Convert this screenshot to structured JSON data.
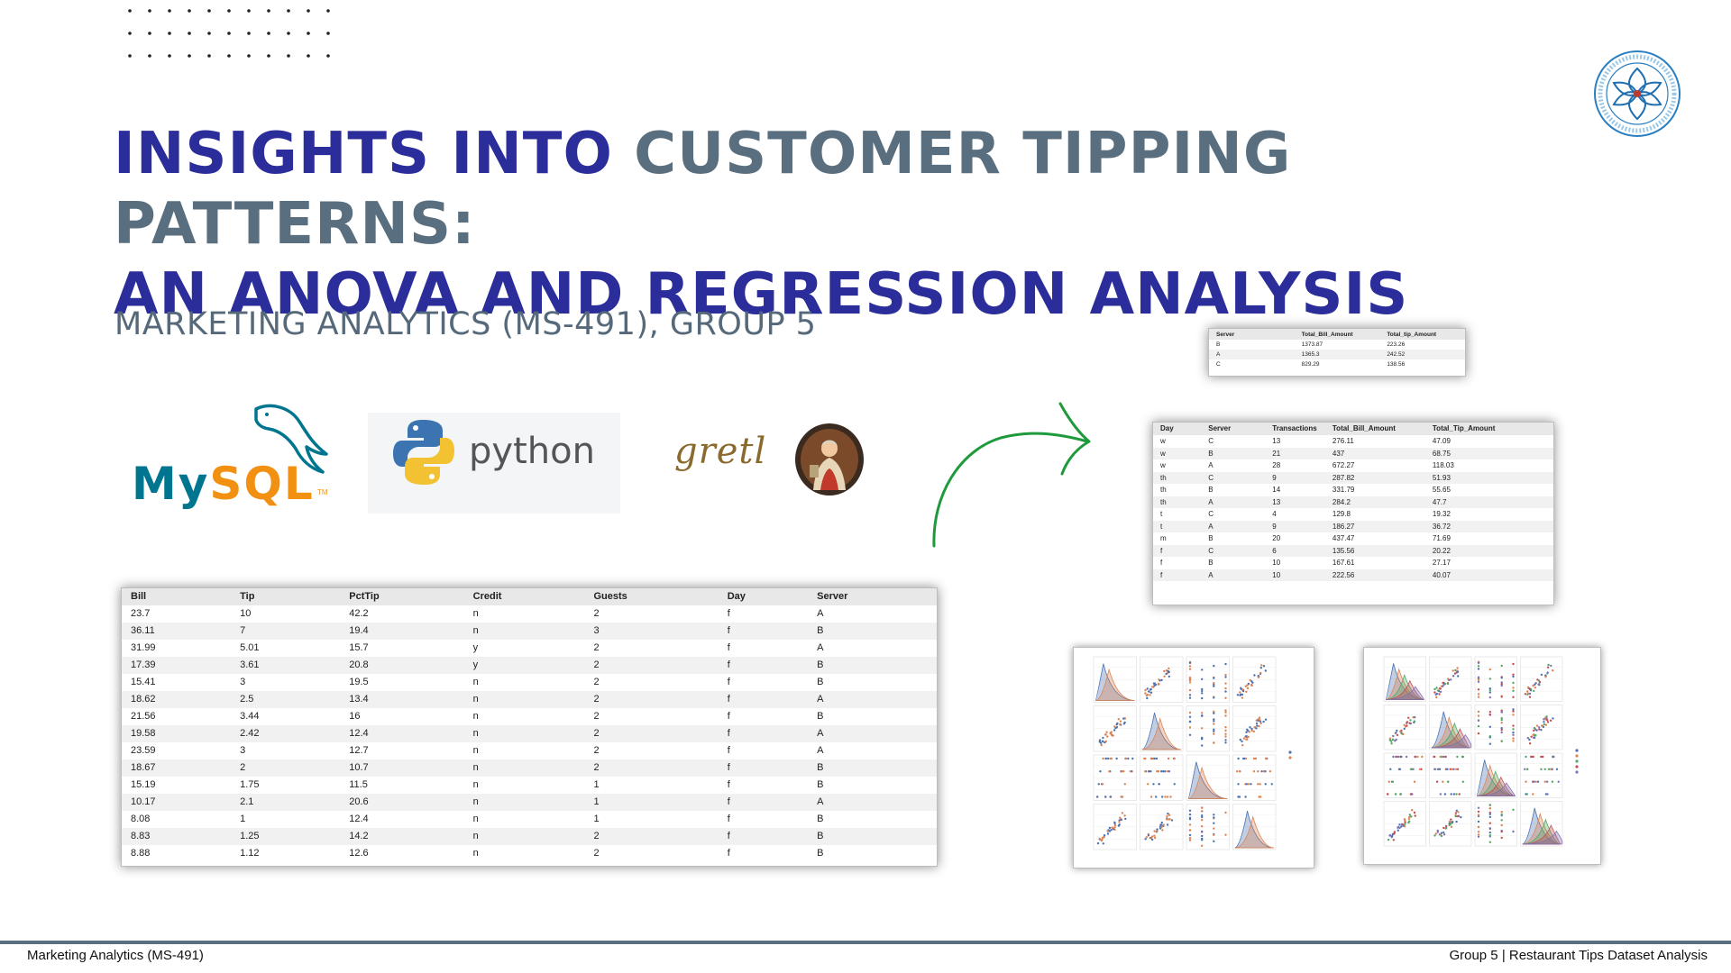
{
  "title": {
    "part1": "INSIGHTS INTO ",
    "part2": "CUSTOMER TIPPING PATTERNS:",
    "line2": "AN ANOVA AND REGRESSION ANALYSIS"
  },
  "subtitle": "MARKETING ANALYTICS (MS-491), GROUP 5",
  "logos": {
    "mysql": {
      "my": "My",
      "sql": "SQL",
      "tm": "TM"
    },
    "python": "python",
    "gretl": "gretl"
  },
  "colors": {
    "title_blue": "#2a2d9a",
    "title_grey": "#596f7f",
    "arrow_green": "#1e9a3c",
    "footer_line": "#596f7f"
  },
  "icons": [
    "seal-icon",
    "dolphin-icon",
    "python-snake-icon",
    "gretl-image",
    "arrow-icon"
  ],
  "main_table": {
    "headers": [
      "Bill",
      "Tip",
      "PctTip",
      "Credit",
      "Guests",
      "Day",
      "Server"
    ],
    "rows": [
      [
        "23.7",
        "10",
        "42.2",
        "n",
        "2",
        "f",
        "A"
      ],
      [
        "36.11",
        "7",
        "19.4",
        "n",
        "3",
        "f",
        "B"
      ],
      [
        "31.99",
        "5.01",
        "15.7",
        "y",
        "2",
        "f",
        "A"
      ],
      [
        "17.39",
        "3.61",
        "20.8",
        "y",
        "2",
        "f",
        "B"
      ],
      [
        "15.41",
        "3",
        "19.5",
        "n",
        "2",
        "f",
        "B"
      ],
      [
        "18.62",
        "2.5",
        "13.4",
        "n",
        "2",
        "f",
        "A"
      ],
      [
        "21.56",
        "3.44",
        "16",
        "n",
        "2",
        "f",
        "B"
      ],
      [
        "19.58",
        "2.42",
        "12.4",
        "n",
        "2",
        "f",
        "A"
      ],
      [
        "23.59",
        "3",
        "12.7",
        "n",
        "2",
        "f",
        "A"
      ],
      [
        "18.67",
        "2",
        "10.7",
        "n",
        "2",
        "f",
        "B"
      ],
      [
        "15.19",
        "1.75",
        "11.5",
        "n",
        "1",
        "f",
        "B"
      ],
      [
        "10.17",
        "2.1",
        "20.6",
        "n",
        "1",
        "f",
        "A"
      ],
      [
        "8.08",
        "1",
        "12.4",
        "n",
        "1",
        "f",
        "B"
      ],
      [
        "8.83",
        "1.25",
        "14.2",
        "n",
        "2",
        "f",
        "B"
      ],
      [
        "8.88",
        "1.12",
        "12.6",
        "n",
        "2",
        "f",
        "B"
      ]
    ]
  },
  "server_summary": {
    "headers": [
      "Server",
      "Total_Bill_Amount",
      "Total_tip_Amount"
    ],
    "rows": [
      [
        "B",
        "1373.87",
        "223.26"
      ],
      [
        "A",
        "1365.3",
        "242.52"
      ],
      [
        "C",
        "829.29",
        "138.56"
      ]
    ]
  },
  "day_server_table": {
    "headers": [
      "Day",
      "Server",
      "Transactions",
      "Total_Bill_Amount",
      "Total_Tip_Amount"
    ],
    "rows": [
      [
        "w",
        "C",
        "13",
        "276.11",
        "47.09"
      ],
      [
        "w",
        "B",
        "21",
        "437",
        "68.75"
      ],
      [
        "w",
        "A",
        "28",
        "672.27",
        "118.03"
      ],
      [
        "th",
        "C",
        "9",
        "287.82",
        "51.93"
      ],
      [
        "th",
        "B",
        "14",
        "331.79",
        "55.65"
      ],
      [
        "th",
        "A",
        "13",
        "284.2",
        "47.7"
      ],
      [
        "t",
        "C",
        "4",
        "129.8",
        "19.32"
      ],
      [
        "t",
        "A",
        "9",
        "186.27",
        "36.72"
      ],
      [
        "m",
        "B",
        "20",
        "437.47",
        "71.69"
      ],
      [
        "f",
        "C",
        "6",
        "135.56",
        "20.22"
      ],
      [
        "f",
        "B",
        "10",
        "167.61",
        "27.17"
      ],
      [
        "f",
        "A",
        "10",
        "222.56",
        "40.07"
      ]
    ]
  },
  "footer": {
    "left": "Marketing Analytics (MS-491)",
    "right": "Group 5 | Restaurant Tips Dataset Analysis"
  }
}
